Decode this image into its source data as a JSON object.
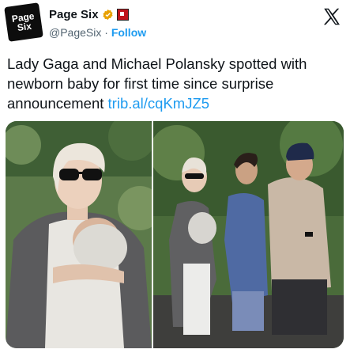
{
  "account": {
    "display_name": "Page Six",
    "handle": "@PageSix",
    "separator": "·",
    "follow_label": "Follow",
    "avatar_text_line1": "Page",
    "avatar_text_line2": "Six",
    "verified_color": "#e8a100",
    "affiliate_color": "#c0151c"
  },
  "tweet": {
    "text": "Lady Gaga and Michael Polansky spotted with newborn baby for first time since surprise announcement",
    "link": "trib.al/cqKmJZ5",
    "link_color": "#1d9bf0"
  },
  "media": {
    "photo_count": 2,
    "photos": [
      "woman-with-baby-sling",
      "couple-walking-with-baby"
    ]
  },
  "icons": {
    "brand": "x-logo-icon",
    "verified": "verified-badge-icon",
    "affiliate": "affiliate-badge-icon"
  }
}
